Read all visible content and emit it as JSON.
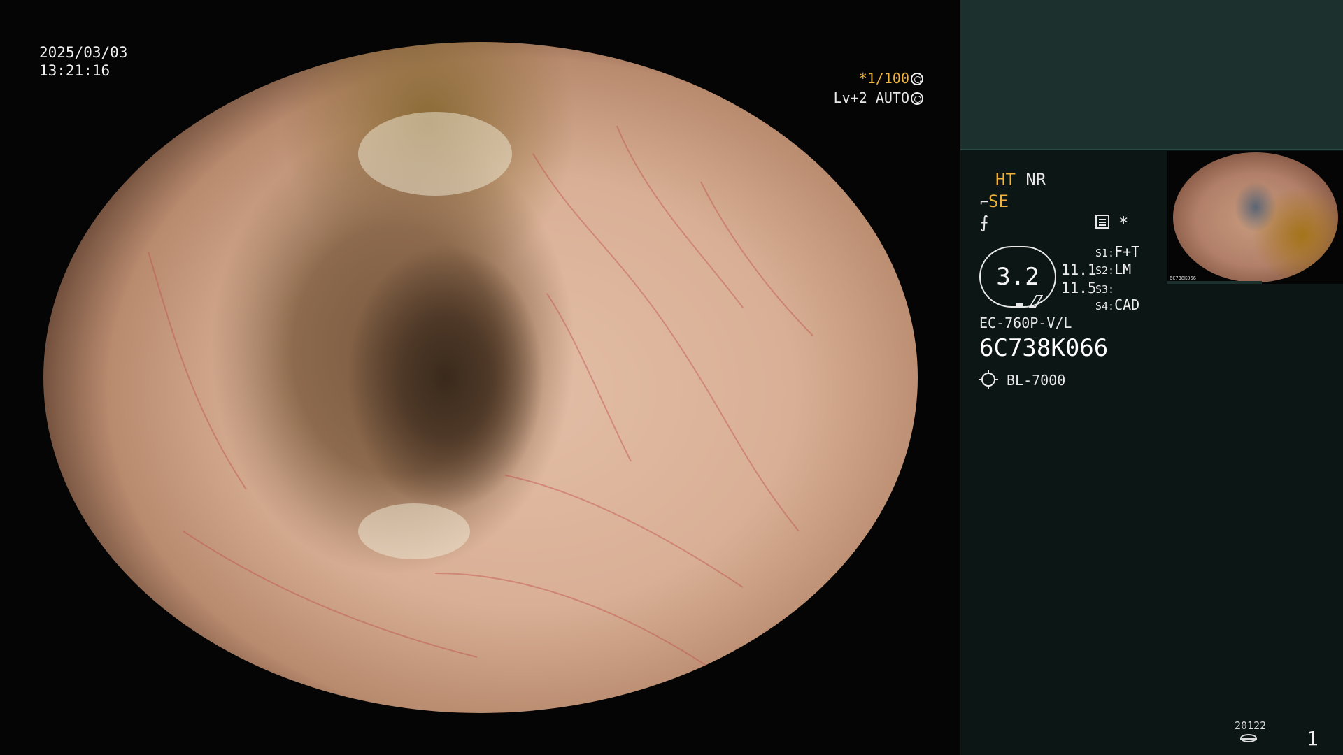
{
  "endoscopic_view": {
    "date": "2025/03/03",
    "time": "13:21:16",
    "shutter_speed": "*1/100",
    "brightness": "Lv+2 AUTO"
  },
  "side_panel": {
    "ht_label": "HT",
    "nr_label": "NR",
    "se_label": "SE",
    "f_symbol": "⨍",
    "star_symbol": "*",
    "zoom_value": "3.2",
    "value_1": "11.1",
    "value_2": "11.5",
    "switches": [
      {
        "key": "S1:",
        "value": "F+T"
      },
      {
        "key": "S2:",
        "value": "LM"
      },
      {
        "key": "S3:",
        "value": ""
      },
      {
        "key": "S4:",
        "value": "CAD"
      }
    ],
    "scope_model": "EC-760P-V/L",
    "scope_serial": "6C738K066",
    "light_source": "BL-7000",
    "thumbnail_id": "6C738K066",
    "image_counter": "20122",
    "page_number": "1"
  },
  "colors": {
    "accent_yellow": "#f2b33a",
    "panel_background": "#0c1614",
    "panel_top_background": "#1c302d"
  }
}
